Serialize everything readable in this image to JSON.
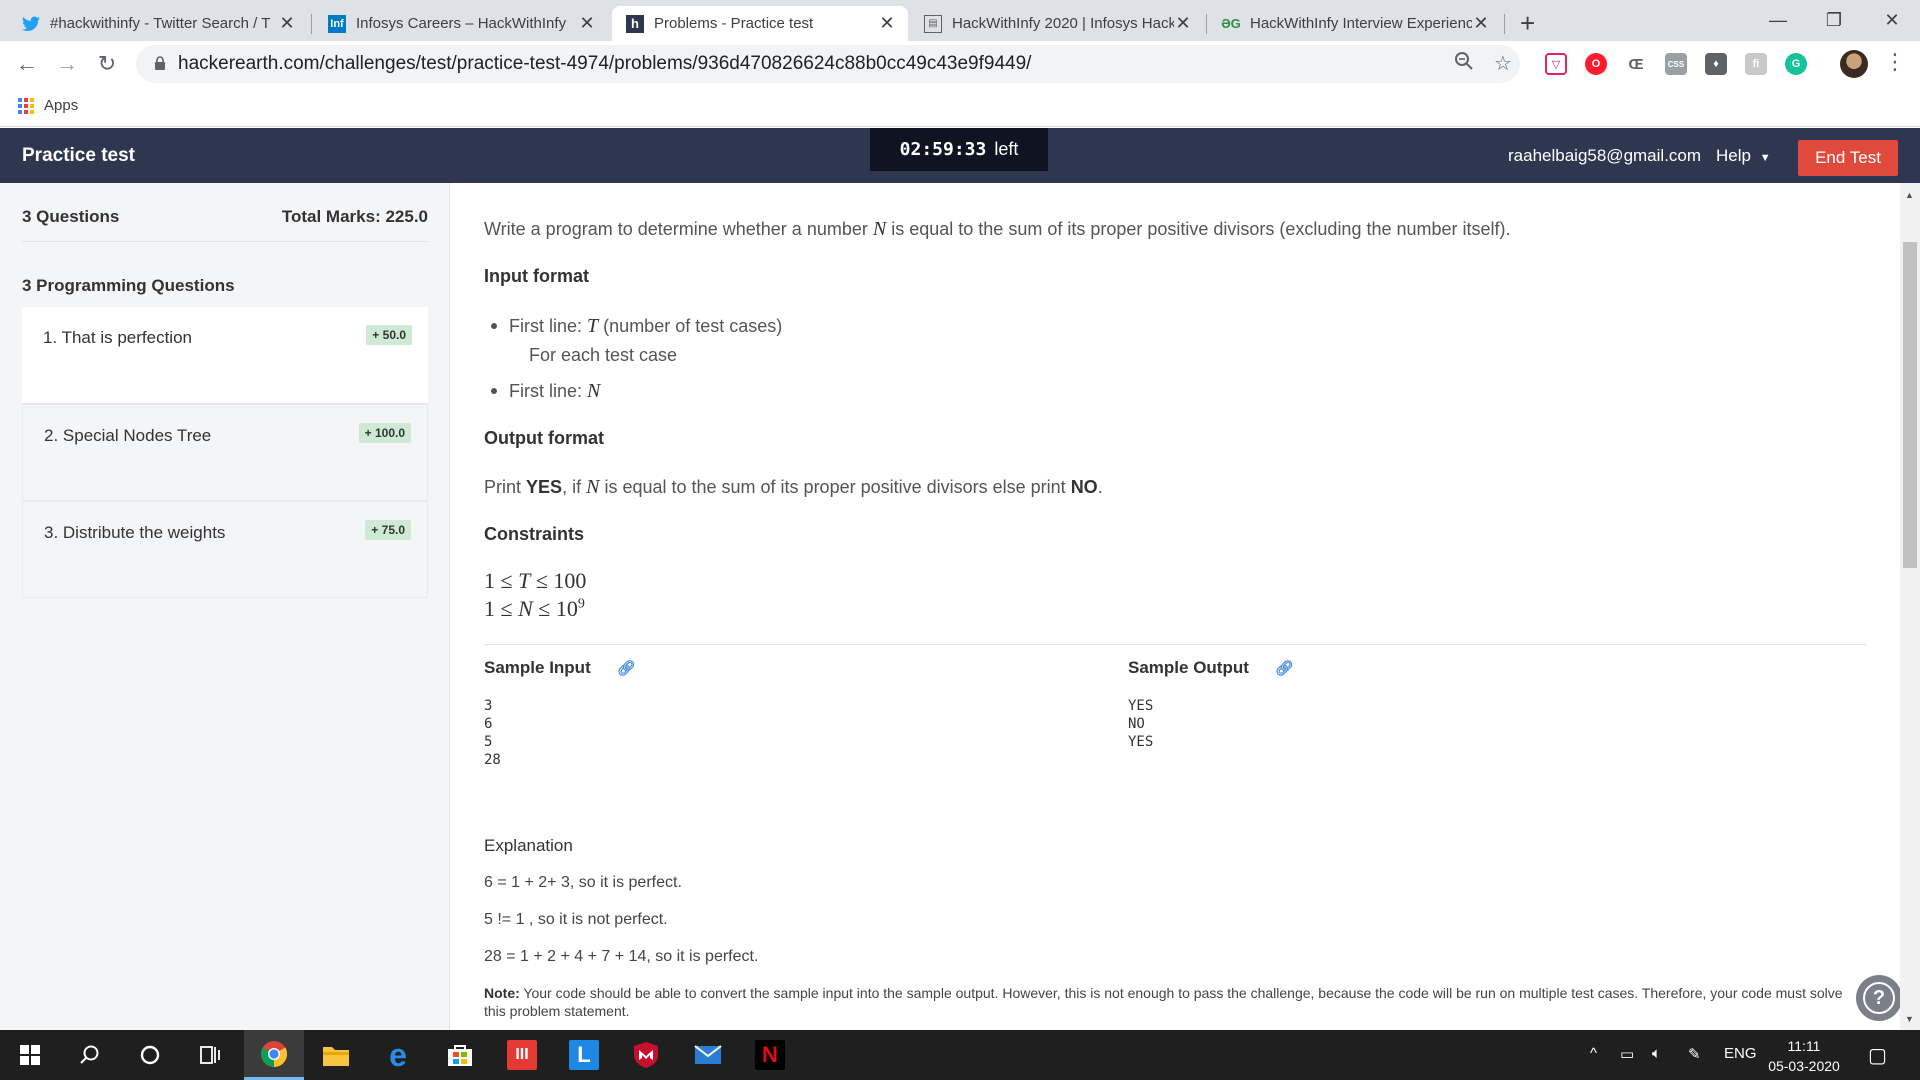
{
  "browser": {
    "tabs": [
      {
        "title": "#hackwithinfy - Twitter Search / T",
        "favicon": "twitter-icon"
      },
      {
        "title": "Infosys Careers – HackWithInfy",
        "favicon": "infosys-icon"
      },
      {
        "title": "Problems - Practice test",
        "favicon": "hackerearth-icon"
      },
      {
        "title": "HackWithInfy 2020 | Infosys Hack",
        "favicon": "page-icon"
      },
      {
        "title": "HackWithInfy Interview Experienc",
        "favicon": "geeksforgeeks-icon"
      }
    ],
    "url": "hackerearth.com/challenges/test/practice-test-4974/problems/936d470826624c88b0cc49c43e9f9449/",
    "bookmarks": {
      "apps_label": "Apps"
    }
  },
  "header": {
    "title": "Practice test",
    "timer": "02:59:33",
    "timer_suffix": "left",
    "user_email": "raahelbaig58@gmail.com",
    "help_label": "Help",
    "end_test_label": "End Test"
  },
  "sidebar": {
    "questions_count": "3 Questions",
    "total_marks": "Total Marks: 225.0",
    "section_title": "3 Programming Questions",
    "questions": [
      {
        "label": "1. That is perfection",
        "marks": "+ 50.0"
      },
      {
        "label": "2. Special Nodes Tree",
        "marks": "+ 100.0"
      },
      {
        "label": "3. Distribute the weights",
        "marks": "+ 75.0"
      }
    ]
  },
  "problem": {
    "statement_before": "Write a program to determine whether a number",
    "statement_var": "N",
    "statement_after": "is equal to the sum of its proper positive divisors (excluding the number itself).",
    "input_heading": "Input format",
    "input_line1_prefix": "First line:",
    "input_line1_var": "T",
    "input_line1_suffix": "(number of test cases)",
    "input_for_each": "For each test case",
    "input_line2_prefix": "First line:",
    "input_line2_var": "N",
    "output_heading": "Output format",
    "output_p1": "Print",
    "output_yes": "YES",
    "output_p2": ", if",
    "output_var": "N",
    "output_p3": "is equal to the sum of its proper positive divisors else print",
    "output_no": "NO",
    "output_p4": ".",
    "constraints_heading": "Constraints",
    "constraint1": {
      "lower": "1",
      "var": "T",
      "upper": "100"
    },
    "constraint2": {
      "lower": "1",
      "var": "N",
      "upper_base": "10",
      "upper_exp": "9"
    },
    "rel_symbol": "≤",
    "sample_input_label": "Sample Input",
    "sample_input": "3\n6\n5\n28",
    "sample_output_label": "Sample Output",
    "sample_output": "YES\nNO\nYES",
    "explanation_heading": "Explanation",
    "explanation": [
      "6 = 1 + 2+ 3, so it is perfect.",
      "5 != 1 , so it is not perfect.",
      "28 = 1 + 2 + 4 + 7 + 14, so it is perfect."
    ],
    "note_label": "Note:",
    "note_text": "Your code should be able to convert the sample input into the sample output. However, this is not enough to pass the challenge, because the code will be run on multiple test cases. Therefore, your code must solve this problem statement."
  },
  "taskbar": {
    "tray_language": "ENG",
    "time": "11:11",
    "date": "05-03-2020"
  }
}
